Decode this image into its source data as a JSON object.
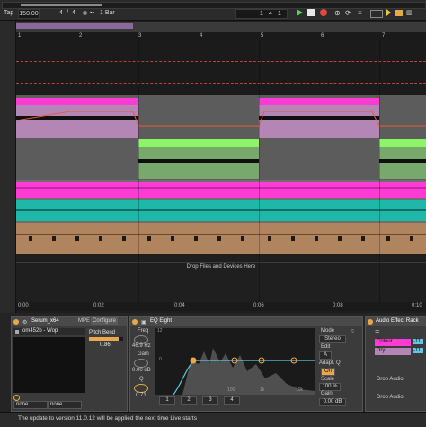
{
  "transport": {
    "tap_label": "Tap",
    "tempo": "150.00",
    "signature_num": "4",
    "signature_sep": "/",
    "signature_den": "4",
    "quantize": "1 Bar",
    "position_bar": "1",
    "position_beat": "4",
    "position_sub": "1"
  },
  "ruler": {
    "bars": [
      "1",
      "2",
      "3",
      "4",
      "5",
      "6",
      "7"
    ]
  },
  "arrangement": {
    "drop_hint": "Drop Files and Devices Here"
  },
  "timeline": {
    "ticks": [
      "0:00",
      "0:02",
      "0:04",
      "0:06",
      "0:08",
      "0:10"
    ]
  },
  "devices": {
    "instrument": {
      "title": "Serum_x64",
      "mpe_label": "MPE",
      "configure_label": "Configure",
      "preset": "om452b - Wop",
      "param_name": "Pitch Bend",
      "param_value": "0.86",
      "dropdown_a": "none",
      "dropdown_b": "none"
    },
    "eq": {
      "title": "EQ Eight",
      "freq_label": "Freq",
      "freq_value": "46.9 Hz",
      "gain_label": "Gain",
      "gain_value": "0.00 dB",
      "q_label": "Q",
      "q_value": "0.71",
      "scale_max": "12",
      "scale_mid": "0",
      "freq_ticks": [
        "100",
        "1k",
        "10k"
      ],
      "mode_label": "Mode",
      "mode_value": "Stereo",
      "edit_label": "Edit",
      "edit_a": "A",
      "adapt_label": "Adapt. Q",
      "adapt_value": "On",
      "scale_label": "Scale",
      "scale_value": "100 %",
      "gain2_label": "Gain",
      "gain2_value": "0.00 dB",
      "band_numbers": [
        "1",
        "2",
        "3",
        "4"
      ]
    },
    "rack": {
      "title": "Audio Effect Rack",
      "chain_a": "Colour",
      "chain_a_value": "-11.",
      "chain_b": "Dry",
      "chain_b_value": "-11.",
      "drop_hint_a": "Drop Audio",
      "drop_hint_b": "Drop Audio"
    }
  },
  "status": {
    "message": "The update to version 11.0.12 will be applied the next time Live starts"
  },
  "colors": {
    "magenta": "#ff3bd6",
    "mauve": "#b486b6",
    "lime": "#8cf567",
    "green": "#79a86d",
    "teal": "#1fb8a8",
    "orange": "#b18460",
    "playhead": "#ffffff",
    "automation": "#e85a3c"
  }
}
